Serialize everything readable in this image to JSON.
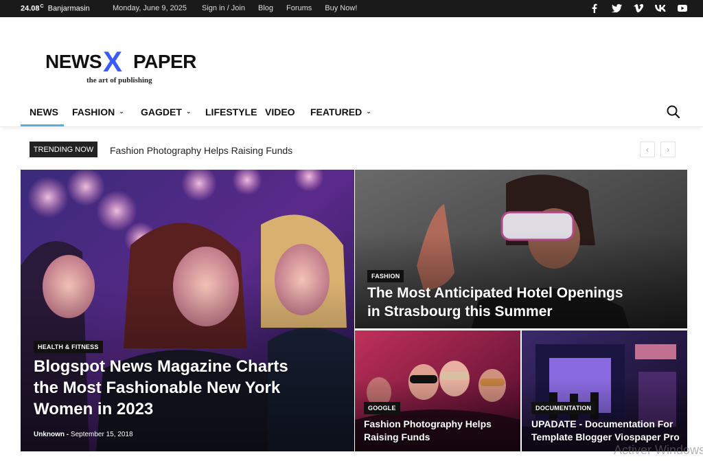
{
  "topbar": {
    "temperature": "24.08",
    "unit": "C",
    "city": "Banjarmasin",
    "date": "Monday, June 9, 2025",
    "links": [
      "Sign in / Join",
      "Blog",
      "Forums",
      "Buy Now!"
    ],
    "social_icons": [
      "facebook-icon",
      "twitter-icon",
      "vimeo-icon",
      "vk-icon",
      "youtube-icon"
    ]
  },
  "logo": {
    "part1": "NEWS",
    "part2": "X",
    "part3": "PAPER",
    "tagline": "the art of publishing",
    "accent_color": "#3b5bff"
  },
  "nav": {
    "items": [
      {
        "label": "NEWS",
        "dropdown": false,
        "active": true
      },
      {
        "label": "FASHION",
        "dropdown": true
      },
      {
        "label": "GAGDET",
        "dropdown": true
      },
      {
        "label": "LIFESTYLE",
        "dropdown": false
      },
      {
        "label": "VIDEO",
        "dropdown": false
      },
      {
        "label": "FEATURED",
        "dropdown": true
      }
    ],
    "active_color": "#4db2ec"
  },
  "trending": {
    "label": "TRENDING NOW",
    "text": "Fashion Photography Helps Raising Funds",
    "prev": "‹",
    "next": "›"
  },
  "featured": [
    {
      "category": "HEALTH & FITNESS",
      "title_lines": [
        "Blogspot News Magazine Charts",
        "the Most Fashionable New York",
        "Women in 2023"
      ],
      "author": "Unknown",
      "separator": "-",
      "date": "September 15, 2018"
    },
    {
      "category": "FASHION",
      "title_lines": [
        "The Most Anticipated Hotel Openings",
        "in Strasbourg this Summer"
      ]
    },
    {
      "category": "GOOGLE",
      "title_lines": [
        "Fashion Photography Helps",
        "Raising Funds"
      ]
    },
    {
      "category": "DOCUMENTATION",
      "title_lines": [
        "UPADATE - Documentation For",
        "Template Blogger Viospaper Pro"
      ]
    }
  ],
  "overlay": {
    "watermark": "Activer Windows"
  }
}
